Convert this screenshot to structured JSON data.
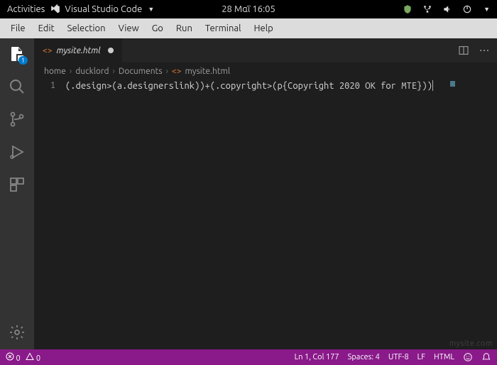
{
  "topbar": {
    "activities": "Activities",
    "app_name": "Visual Studio Code",
    "datetime": "28 Μαΐ 16:05"
  },
  "menubar": {
    "items": [
      "File",
      "Edit",
      "Selection",
      "View",
      "Go",
      "Run",
      "Terminal",
      "Help"
    ]
  },
  "activitybar": {
    "explorer_badge": "1"
  },
  "tab": {
    "filename": "mysite.html"
  },
  "breadcrumbs": {
    "parts": [
      "home",
      "ducklord",
      "Documents",
      "mysite.html"
    ]
  },
  "editor": {
    "line_number": "1",
    "content": "(.design>(a.designerslink))+(.copyright>(p{Copyright 2020 OK for MTE}))"
  },
  "statusbar": {
    "errors": "0",
    "warnings": "0",
    "ln_col": "Ln 1, Col 177",
    "spaces": "Spaces: 4",
    "encoding": "UTF-8",
    "eol": "LF",
    "language": "HTML"
  },
  "watermark": "mysite.com"
}
